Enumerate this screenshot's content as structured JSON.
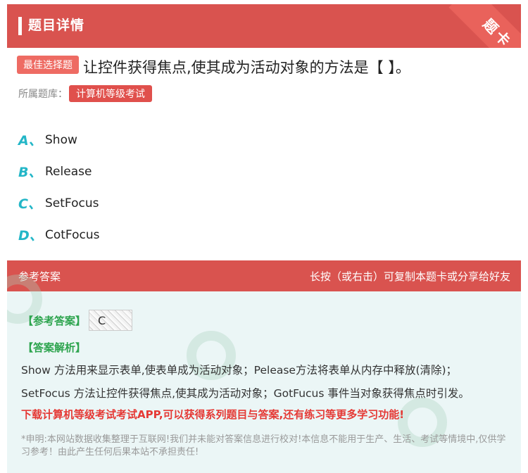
{
  "header": {
    "title": "题目详情",
    "corner": "题卡"
  },
  "question": {
    "type": "最佳选择题",
    "text": "让控件获得焦点,使其成为活动对象的方法是【 】。",
    "bank_label": "所属题库：",
    "bank": "计算机等级考试"
  },
  "options": [
    {
      "letter": "A、",
      "text": "Show"
    },
    {
      "letter": "B、",
      "text": "Release"
    },
    {
      "letter": "C、",
      "text": "SetFocus"
    },
    {
      "letter": "D、",
      "text": "CotFocus"
    }
  ],
  "answer": {
    "head_left": "参考答案",
    "head_right": "长按（或右击）可复制本题卡或分享给好友",
    "ref_label": "【参考答案】",
    "ref_value": "C",
    "analysis_label": "【答案解析】",
    "analysis": "Show 方法用来显示表单,使表单成为活动对象；Pelease方法将表单从内存中释放(清除)；SetFocus 方法让控件获得焦点,使其成为活动对象；GotFucus 事件当对象获得焦点时引发。",
    "promo": "下载计算机等级考试考试APP,可以获得系列题目与答案,还有练习等更多学习功能!",
    "disclaimer": "*申明:本网站数据收集整理于互联网!我们并未能对答案信息进行校对!本信息不能用于生产、生活、考试等情境中,仅供学习参考！由此产生任何后果本站不承担责任!"
  },
  "colors": {
    "red": "#d9534f",
    "teal": "#23b6c7",
    "green": "#2da44e",
    "promo": "#e53935"
  }
}
